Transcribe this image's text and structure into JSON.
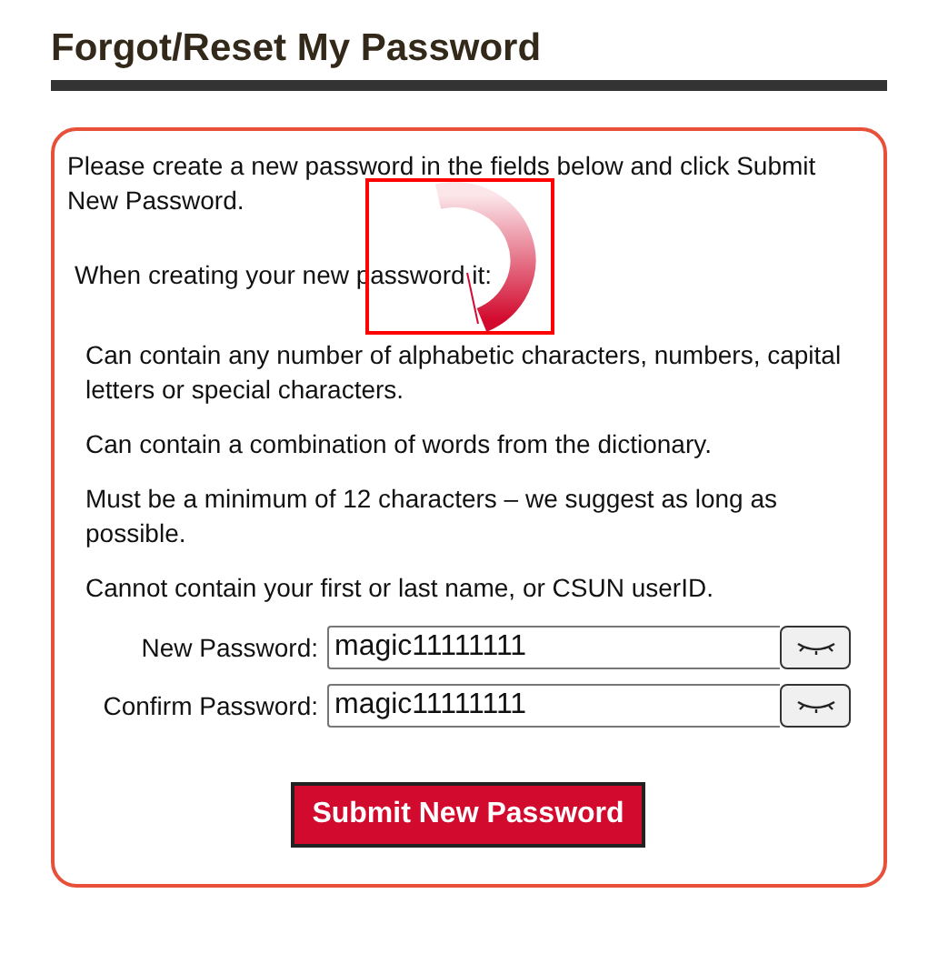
{
  "page_title": "Forgot/Reset My Password",
  "intro": "Please create a new password in the fields below and click Submit New Password.",
  "rules_heading": "When creating your new password it:",
  "rules": [
    "Can contain any number of alphabetic characters, numbers, capital letters or special characters.",
    "Can contain a combination of words from the dictionary.",
    "Must be a minimum of 12 characters – we suggest as long as possible.",
    "Cannot contain your first or last name, or CSUN userID."
  ],
  "fields": [
    {
      "label": "New Password:",
      "value": "magic11111111"
    },
    {
      "label": "Confirm Password:",
      "value": "magic11111111"
    }
  ],
  "submit_button": "Submit New Password",
  "loading": true
}
